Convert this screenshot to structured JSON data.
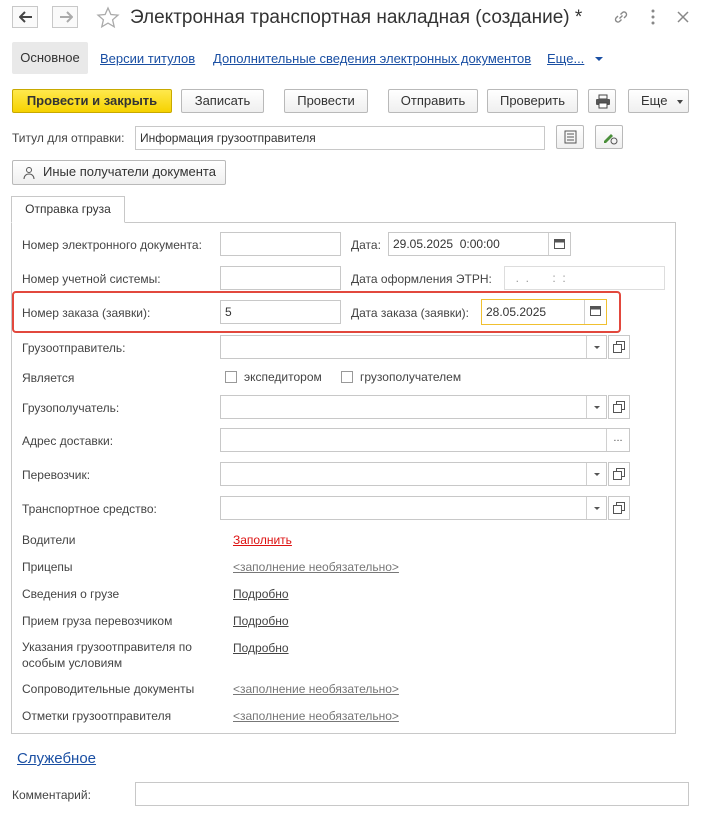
{
  "window": {
    "title": "Электронная транспортная накладная (создание) *"
  },
  "tabs": {
    "main": "Основное",
    "versions": "Версии титулов",
    "extra": "Дополнительные сведения электронных документов",
    "more": "Еще..."
  },
  "toolbar": {
    "post_close": "Провести и закрыть",
    "save": "Записать",
    "post": "Провести",
    "send": "Отправить",
    "check": "Проверить",
    "more": "Еще"
  },
  "title_row": {
    "label": "Титул для отправки:",
    "value": "Информация грузоотправителя"
  },
  "other_recipients": "Иные получатели документа",
  "cargo_tab": "Отправка груза",
  "form": {
    "edoc_number_label": "Номер электронного документа:",
    "edoc_number_value": "",
    "date_label": "Дата:",
    "date_value": "29.05.2025  0:00:00",
    "account_number_label": "Номер учетной системы:",
    "account_number_value": "",
    "etrn_date_label": "Дата оформления ЭТРН:",
    "etrn_date_value": "  .  .       :  :",
    "order_number_label": "Номер заказа (заявки):",
    "order_number_value": "5",
    "order_date_label": "Дата заказа (заявки):",
    "order_date_value": "28.05.2025",
    "shipper_label": "Грузоотправитель:",
    "is_label": "Является",
    "forwarder_label": "экспедитором",
    "consignee_check_label": "грузополучателем",
    "consignee_label": "Грузополучатель:",
    "address_label": "Адрес доставки:",
    "carrier_label": "Перевозчик:",
    "vehicle_label": "Транспортное средство:",
    "drivers_label": "Водители",
    "drivers_link": "Заполнить",
    "trailers_label": "Прицепы",
    "trailers_link": "<заполнение необязательно>",
    "cargo_info_label": "Сведения о грузе",
    "cargo_info_link": "Подробно",
    "reception_label": "Прием груза перевозчиком",
    "reception_link": "Подробно",
    "instructions_label_1": "Указания грузоотправителя по",
    "instructions_label_2": "особым условиям",
    "instructions_link": "Подробно",
    "docs_label": "Сопроводительные документы",
    "docs_link": "<заполнение необязательно>",
    "marks_label": "Отметки грузоотправителя",
    "marks_link": "<заполнение необязательно>"
  },
  "service_link": "Служебное",
  "comment_label": "Комментарий:",
  "comment_value": ""
}
